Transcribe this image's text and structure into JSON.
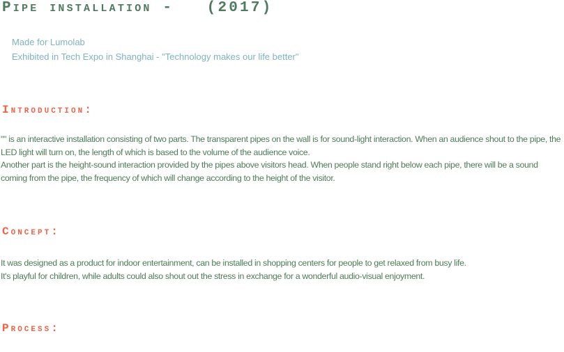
{
  "title": "Pipe installation -   (2017)",
  "meta": {
    "made_for": "Made for Lumolab",
    "exhibited": "Exhibited in Tech Expo in Shanghai - \"Technology makes our life better\""
  },
  "introduction": {
    "heading": "Introduction:",
    "paragraph1": "\"\" is an interactive installation consisting of two parts. The transparent pipes on the wall is for sound-light interaction. When an audience shout to the pipe, the LED light will turn on, the length of which is based to the volume of the audience voice.",
    "paragraph2": "Another part is the height-sound interaction provided by the pipes above visitors head. When people stand right below each pipe, there will be a sound coming from the pipe, the frequency of which will change according to the height of the visitor."
  },
  "concept": {
    "heading": "Concept:",
    "paragraph1": "It was designed as a product for indoor entertainment, can be installed in shopping centers for people to get relaxed from busy life.",
    "paragraph2": "It's playful for children, while adults could also shout out the stress in exchange for a wonderful audio-visual enjoyment."
  },
  "process": {
    "heading": "Process:"
  }
}
